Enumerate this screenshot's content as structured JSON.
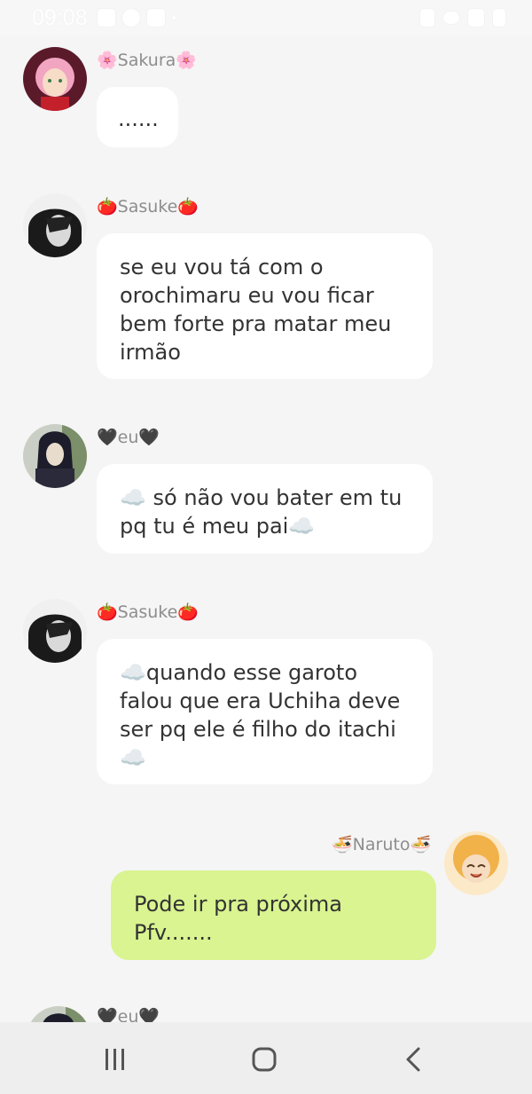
{
  "status_bar": {
    "time": "09:08",
    "left_icons": [
      "gallery-icon",
      "sync-icon",
      "message-icon",
      "dot-icon"
    ],
    "right_icons": [
      "mute-icon",
      "wifi-icon",
      "signal-icon",
      "battery-icon"
    ]
  },
  "messages": [
    {
      "sender": "🌸Sakura🌸",
      "text": "......",
      "mine": false
    },
    {
      "sender": "🍅Sasuke🍅",
      "text": "se eu vou tá com o orochimaru eu vou ficar bem forte pra matar meu irmão",
      "mine": false
    },
    {
      "sender": "🖤eu🖤",
      "text": "☁️ só não vou bater em tu pq tu é meu pai☁️",
      "mine": false
    },
    {
      "sender": "🍅Sasuke🍅",
      "text": "☁️quando esse garoto falou que era Uchiha  deve ser pq ele é filho do itachi ☁️",
      "mine": false
    },
    {
      "sender": "🍜Naruto🍜",
      "text": "Pode ir pra próxima Pfv.......",
      "mine": true
    },
    {
      "sender": "🖤eu🖤",
      "text": "",
      "mine": false
    }
  ],
  "nav_bar": {
    "recents_icon": "recents-icon",
    "home_icon": "home-icon",
    "back_icon": "back-icon"
  },
  "colors": {
    "background": "#f5f5f5",
    "bubble": "#ffffff",
    "my_bubble": "#d9f490",
    "name_text": "#8d8d8d"
  }
}
